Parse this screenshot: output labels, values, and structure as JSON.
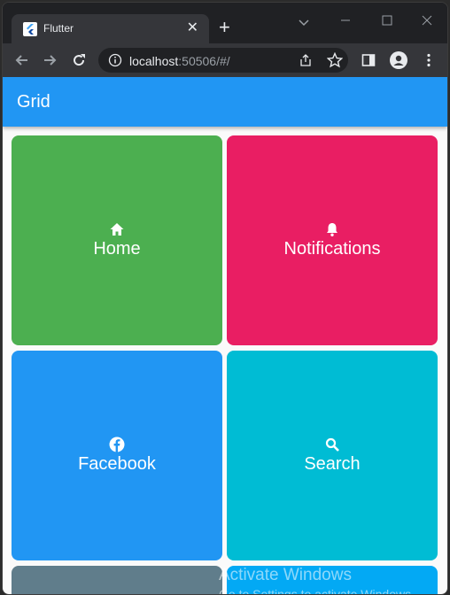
{
  "browser": {
    "tab_title": "Flutter",
    "tab_close": "✕",
    "new_tab": "+",
    "url_host": "localhost",
    "url_rest": ":50506/#/"
  },
  "app": {
    "title": "Grid"
  },
  "tiles": [
    {
      "label": "Home",
      "icon": "home-icon",
      "color": "#4caf50"
    },
    {
      "label": "Notifications",
      "icon": "bell-icon",
      "color": "#e91e63"
    },
    {
      "label": "Facebook",
      "icon": "facebook-icon",
      "color": "#2196f3"
    },
    {
      "label": "Search",
      "icon": "search-icon",
      "color": "#00bcd4"
    },
    {
      "label": "",
      "icon": "",
      "color": "#607d8b"
    },
    {
      "label": "",
      "icon": "",
      "color": "#03a9f4"
    }
  ],
  "watermark": {
    "line1": "Activate Windows",
    "line2": "Go to Settings to activate Windows."
  },
  "colors": {
    "appbar": "#2196f3",
    "chrome_dark": "#202124",
    "chrome_toolbar": "#35363a"
  }
}
